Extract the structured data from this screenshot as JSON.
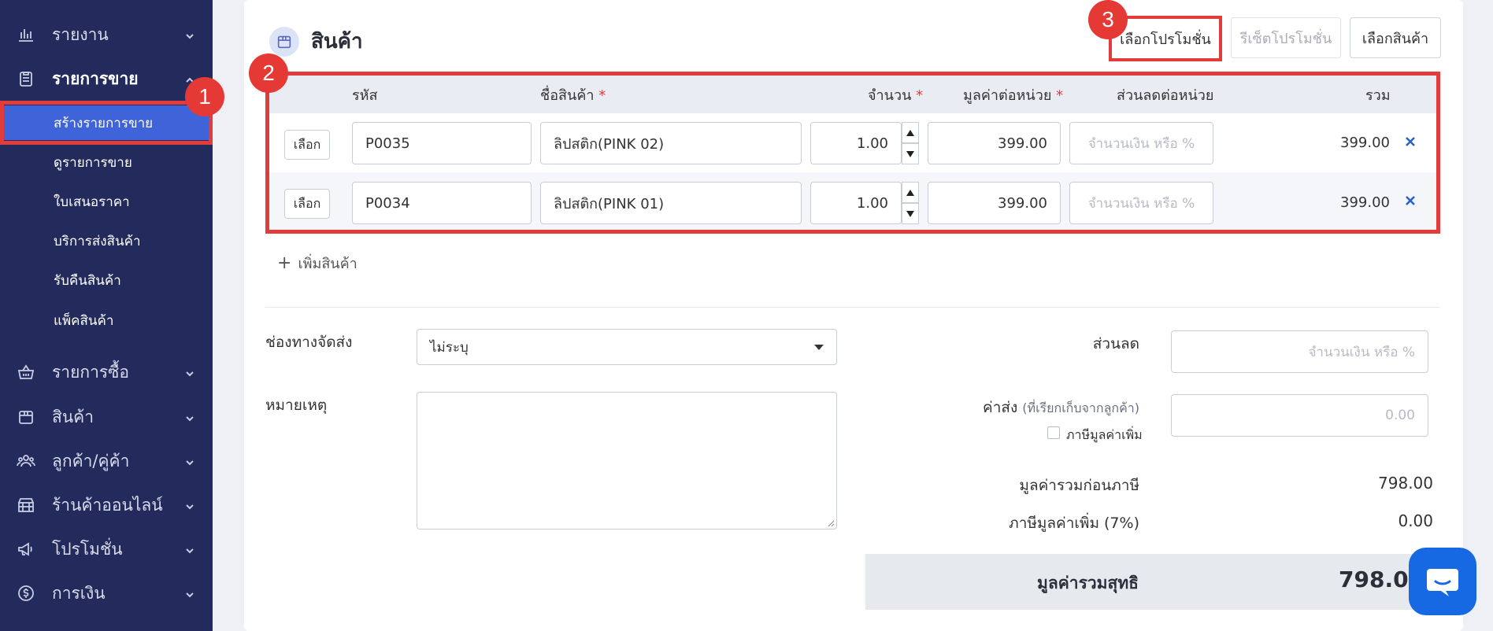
{
  "sidebar": {
    "items": [
      {
        "label": "รายงาน",
        "icon": "bar-chart-icon"
      },
      {
        "label": "รายการขาย",
        "icon": "clipboard-icon"
      },
      {
        "label": "รายการซื้อ",
        "icon": "basket-icon"
      },
      {
        "label": "สินค้า",
        "icon": "box-icon"
      },
      {
        "label": "ลูกค้า/คู่ค้า",
        "icon": "users-icon"
      },
      {
        "label": "ร้านค้าออนไลน์",
        "icon": "store-icon"
      },
      {
        "label": "โปรโมชั่น",
        "icon": "megaphone-icon"
      },
      {
        "label": "การเงิน",
        "icon": "coin-icon"
      }
    ],
    "sub_items": [
      "สร้างรายการขาย",
      "ดูรายการขาย",
      "ใบเสนอราคา",
      "บริการส่งสินค้า",
      "รับคืนสินค้า",
      "แพ็คสินค้า"
    ]
  },
  "badges": [
    "1",
    "2",
    "3"
  ],
  "section": {
    "title": "สินค้า"
  },
  "buttons": {
    "select_promo": "เลือกโปรโมชั่น",
    "reset_promo": "รีเซ็ตโปรโมชั่น",
    "select_product": "เลือกสินค้า"
  },
  "table": {
    "headers": {
      "code": "รหัส",
      "name": "ชื่อสินค้า",
      "qty": "จำนวน",
      "unit_price": "มูลค่าต่อหน่วย",
      "discount": "ส่วนลดต่อหน่วย",
      "total": "รวม"
    },
    "required_mark": "*",
    "select_label": "เลือก",
    "discount_placeholder": "จำนวนเงิน หรือ %",
    "rows": [
      {
        "code": "P0035",
        "name": "ลิปสติก(PINK 02)",
        "qty": "1.00",
        "unit_price": "399.00",
        "total": "399.00"
      },
      {
        "code": "P0034",
        "name": "ลิปสติก(PINK 01)",
        "qty": "1.00",
        "unit_price": "399.00",
        "total": "399.00"
      }
    ]
  },
  "add_product": "เพิ่มสินค้า",
  "form": {
    "shipping_channel_label": "ช่องทางจัดส่ง",
    "shipping_channel_value": "ไม่ระบุ",
    "note_label": "หมายเหตุ",
    "discount_label": "ส่วนลด",
    "discount_placeholder": "จำนวนเงิน หรือ %",
    "shipping_fee_label": "ค่าส่ง",
    "shipping_fee_hint": "(ที่เรียกเก็บจากลูกค้า)",
    "shipping_fee_placeholder": "0.00",
    "vat_checkbox_label": "ภาษีมูลค่าเพิ่ม"
  },
  "summary": {
    "subtotal_label": "มูลค่ารวมก่อนภาษี",
    "subtotal_value": "798.00",
    "vat_label": "ภาษีมูลค่าเพิ่ม (7%)",
    "vat_value": "0.00",
    "net_label": "มูลค่ารวมสุทธิ",
    "net_value": "798.00"
  },
  "colors": {
    "sidebar": "#232a5c",
    "selected": "#3f63d8",
    "highlight": "#e23b3b",
    "chat": "#1668e3"
  }
}
